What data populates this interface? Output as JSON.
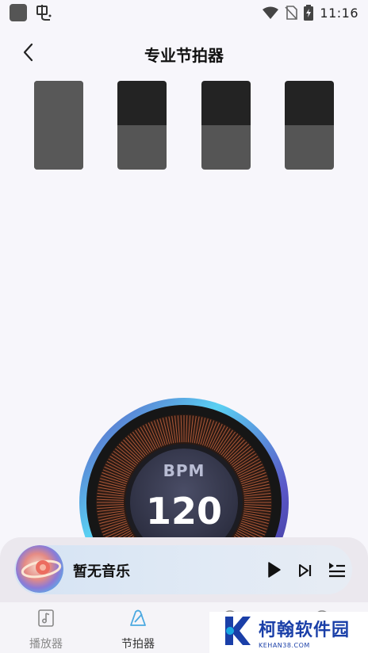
{
  "status_bar": {
    "time": "11:16",
    "icons": [
      "square-icon",
      "app-icon",
      "wifi-icon",
      "no-sim-icon",
      "battery-charging-icon"
    ]
  },
  "header": {
    "title": "专业节拍器",
    "back_icon": "chevron-left-icon"
  },
  "beats": [
    {
      "state": "accent"
    },
    {
      "state": "normal"
    },
    {
      "state": "normal"
    },
    {
      "state": "normal"
    }
  ],
  "dial": {
    "label": "BPM",
    "value": "120"
  },
  "player": {
    "track_title": "暂无音乐",
    "controls": [
      "play-icon",
      "skip-next-icon",
      "playlist-icon"
    ]
  },
  "tabs": [
    {
      "label": "播放器",
      "icon": "music-note-icon",
      "active": false
    },
    {
      "label": "节拍器",
      "icon": "metronome-icon",
      "active": true
    },
    {
      "label": "",
      "icon": "tab-icon-3",
      "active": false
    },
    {
      "label": "",
      "icon": "tab-icon-4",
      "active": false
    }
  ],
  "watermark": {
    "text": "柯翰软件园",
    "sub": "KEHAN38.COM"
  },
  "colors": {
    "background": "#f7f6fb",
    "beat_dark": "#232323",
    "beat_gray": "#555555",
    "dial_rays": "#c4633e",
    "dial_ring_gradient": [
      "#5ad0f2",
      "#5a58c8",
      "#3a2f8a"
    ],
    "watermark_blue": "#1a3fa8"
  }
}
